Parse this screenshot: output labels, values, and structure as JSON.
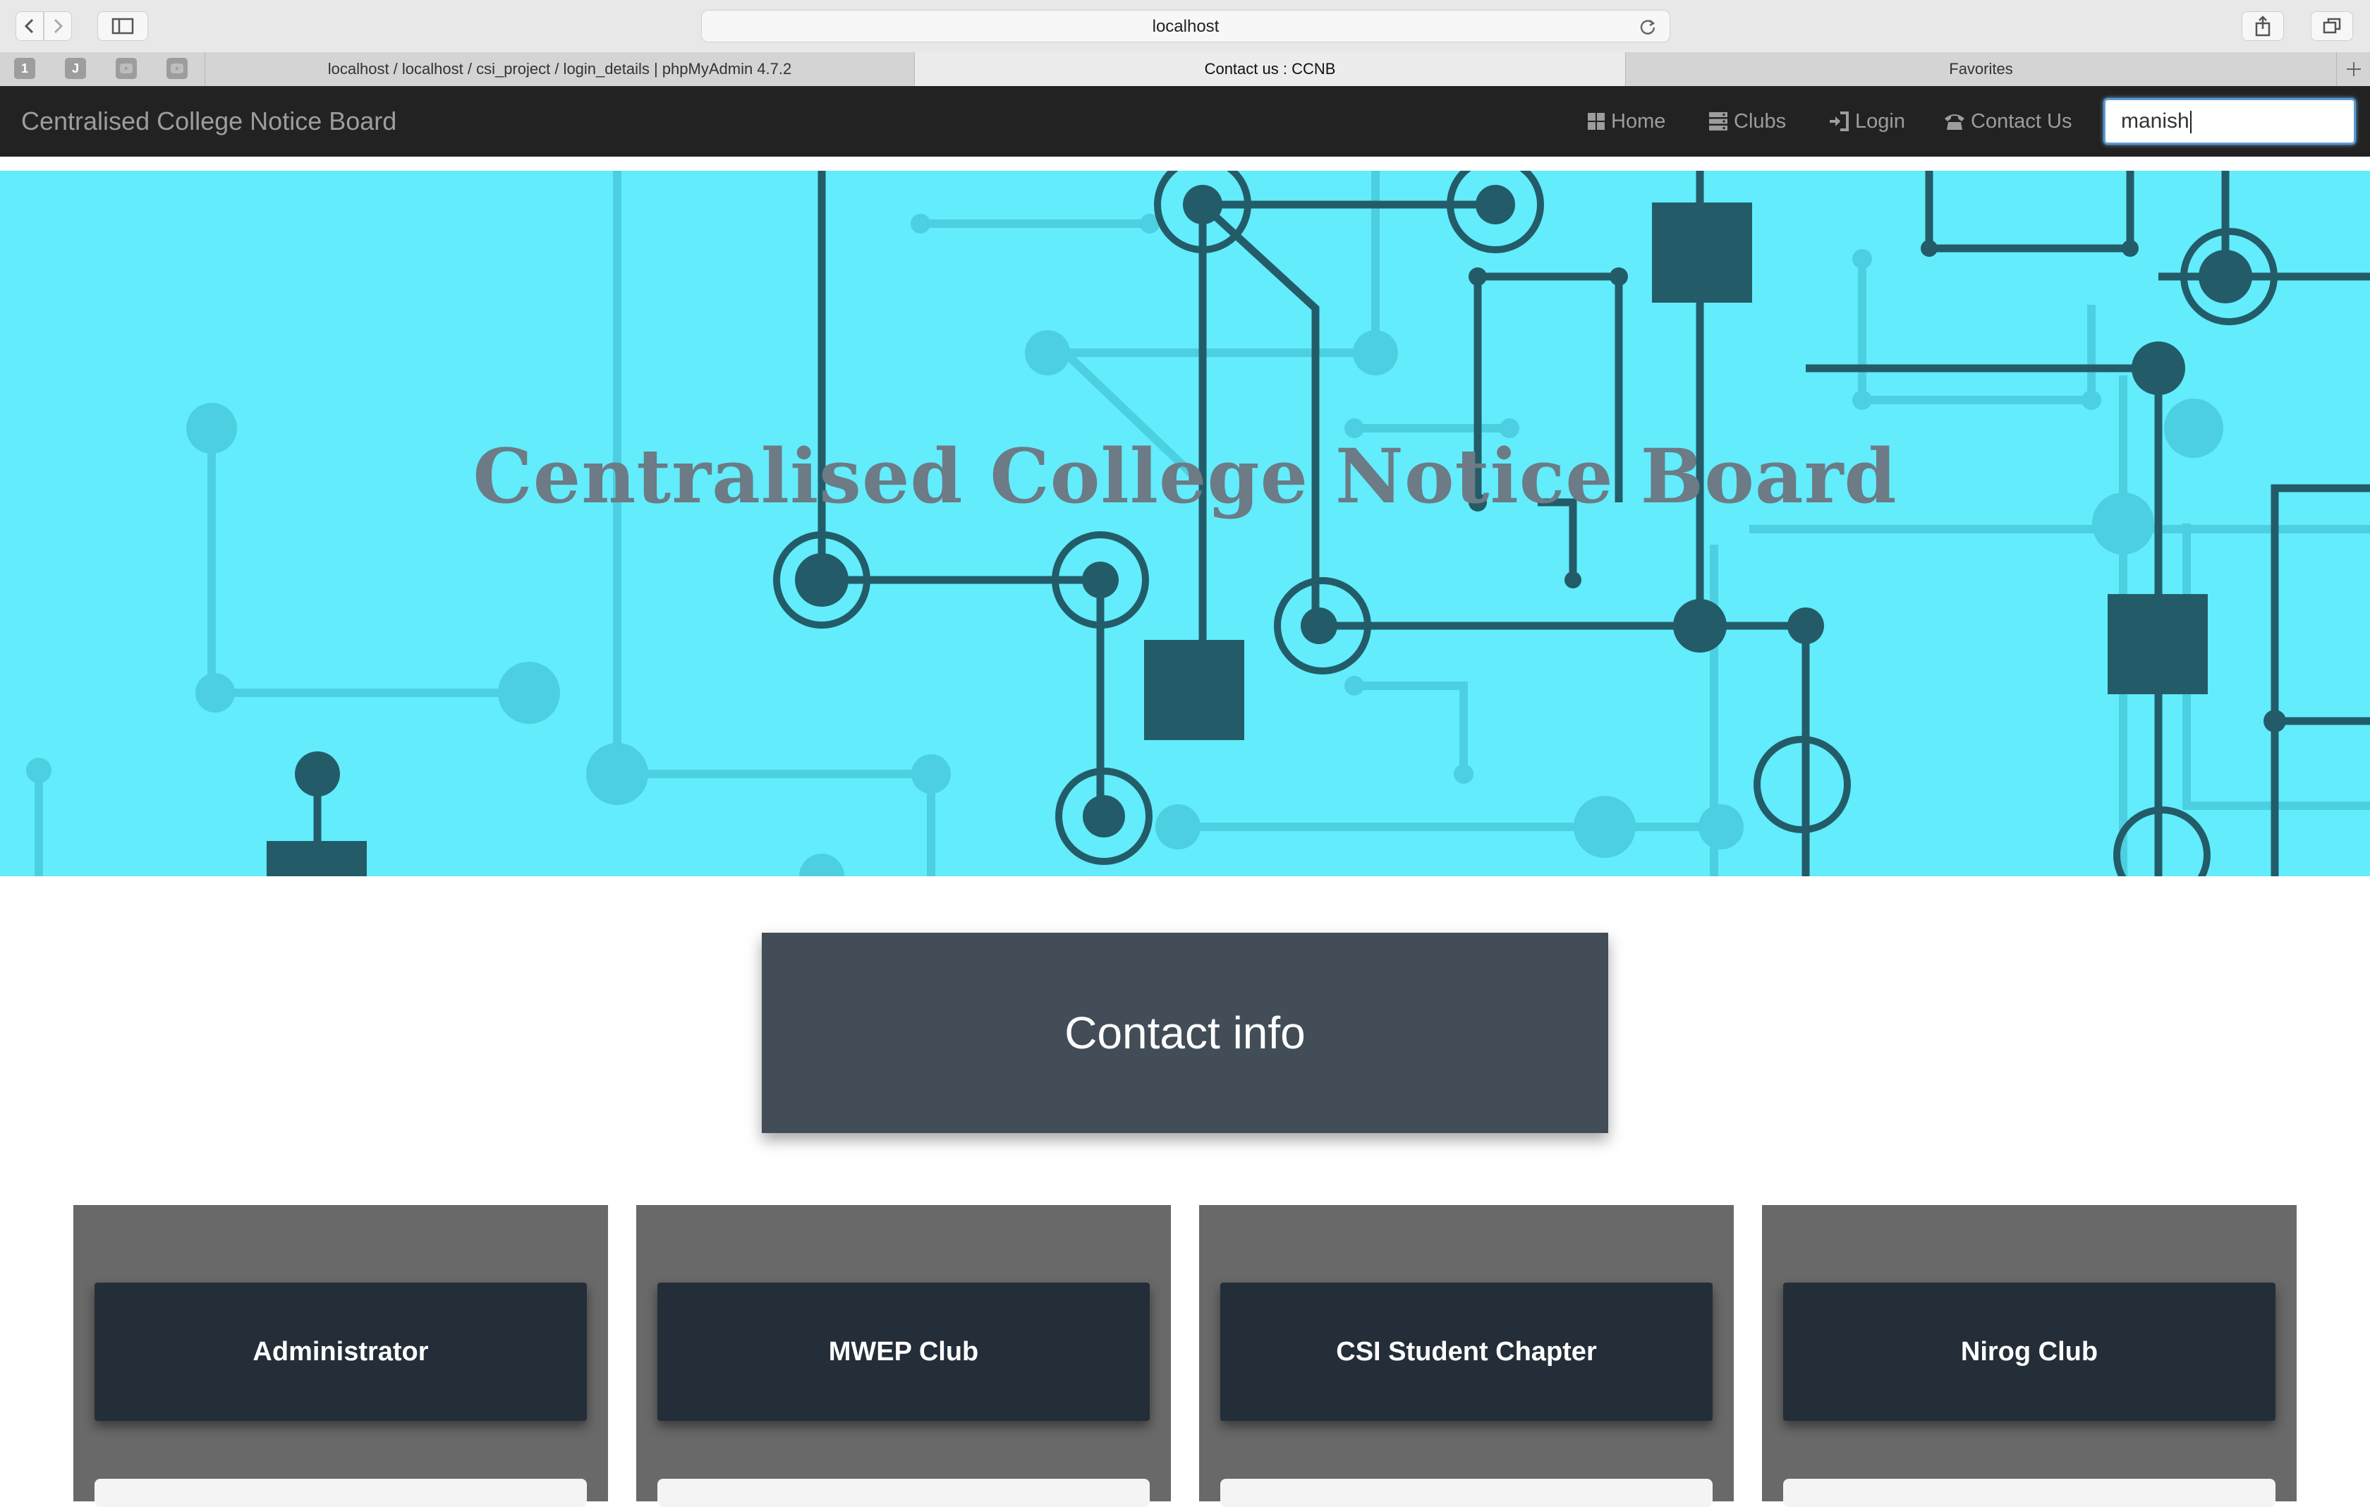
{
  "browser": {
    "address": "localhost",
    "tabs": [
      {
        "label": "localhost / localhost / csi_project / login_details | phpMyAdmin 4.7.2",
        "active": false
      },
      {
        "label": "Contact us : CCNB",
        "active": true
      },
      {
        "label": "Favorites",
        "active": false
      }
    ],
    "pinned": [
      "1",
      "J"
    ]
  },
  "navbar": {
    "brand": "Centralised College Notice Board",
    "items": [
      {
        "label": "Home",
        "icon": "th-large-icon"
      },
      {
        "label": "Clubs",
        "icon": "server-icon"
      },
      {
        "label": "Login",
        "icon": "log-in-icon"
      },
      {
        "label": "Contact Us",
        "icon": "phone-alt-icon"
      }
    ],
    "search_value": "manish"
  },
  "hero": {
    "title": "Centralised College Notice Board"
  },
  "contact": {
    "title": "Contact info",
    "cards": [
      {
        "title": "Administrator"
      },
      {
        "title": "MWEP Club"
      },
      {
        "title": "CSI Student Chapter"
      },
      {
        "title": "Nirog Club"
      }
    ]
  },
  "colors": {
    "hero_bg": "#63ecfb",
    "circuit_dark": "#235c68",
    "navbar_bg": "#222222",
    "panel_bg": "#424d57",
    "card_bg": "#696969",
    "card_head_bg": "#232e38"
  }
}
